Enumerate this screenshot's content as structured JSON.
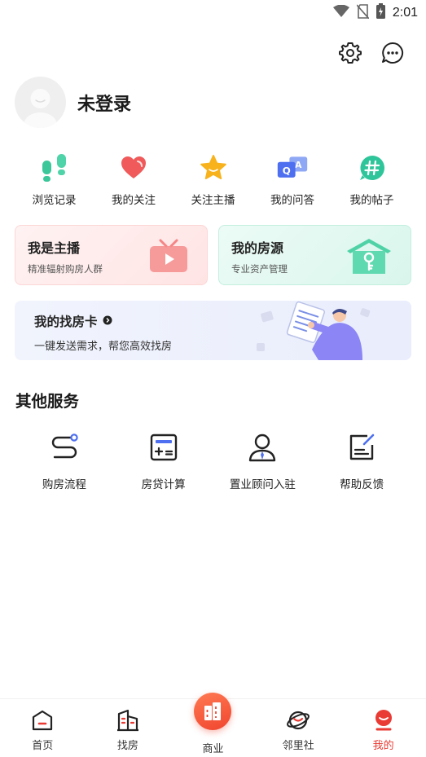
{
  "status_bar": {
    "time": "2:01"
  },
  "profile": {
    "login_text": "未登录"
  },
  "quick_links": [
    {
      "label": "浏览记录",
      "icon": "footprints-icon"
    },
    {
      "label": "我的关注",
      "icon": "heart-icon"
    },
    {
      "label": "关注主播",
      "icon": "star-icon"
    },
    {
      "label": "我的问答",
      "icon": "qa-icon"
    },
    {
      "label": "我的帖子",
      "icon": "hashtag-icon"
    }
  ],
  "cards": {
    "anchor": {
      "title": "我是主播",
      "subtitle": "精准辐射购房人群"
    },
    "listings": {
      "title": "我的房源",
      "subtitle": "专业资产管理"
    }
  },
  "banner": {
    "title": "我的找房卡",
    "subtitle": "一键发送需求，帮您高效找房"
  },
  "other_services": {
    "title": "其他服务",
    "items": [
      {
        "label": "购房流程",
        "icon": "route-icon"
      },
      {
        "label": "房贷计算",
        "icon": "calculator-icon"
      },
      {
        "label": "置业顾问入驻",
        "icon": "consultant-icon"
      },
      {
        "label": "帮助反馈",
        "icon": "feedback-icon"
      }
    ]
  },
  "bottom_nav": [
    {
      "label": "首页",
      "icon": "home-icon"
    },
    {
      "label": "找房",
      "icon": "building-icon"
    },
    {
      "label": "商业",
      "icon": "business-icon"
    },
    {
      "label": "邻里社",
      "icon": "planet-icon"
    },
    {
      "label": "我的",
      "icon": "profile-icon",
      "active": true
    }
  ],
  "colors": {
    "accent": "#e93a33",
    "card_red": "#ffe4e4",
    "card_green": "#d9f6ec",
    "banner": "#eef1fd"
  }
}
